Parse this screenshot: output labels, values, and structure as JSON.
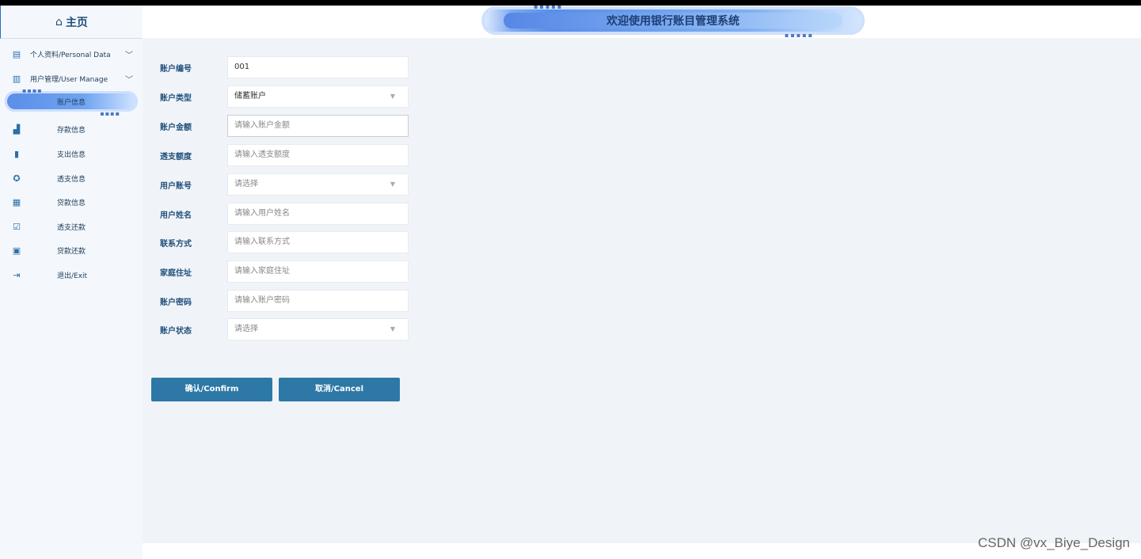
{
  "app": {
    "title": "欢迎使用银行账目管理系统"
  },
  "sidebar": {
    "home_label": "主页",
    "groups": [
      {
        "label": "个人资料/Personal Data",
        "icon": "document-icon"
      },
      {
        "label": "用户管理/User Manage",
        "icon": "clipboard-icon"
      }
    ],
    "active_item": "账户信息",
    "items": [
      {
        "label": "存款信息",
        "icon": "bar-chart-icon"
      },
      {
        "label": "支出信息",
        "icon": "bookmark-icon"
      },
      {
        "label": "透支信息",
        "icon": "badge-icon"
      },
      {
        "label": "贷款信息",
        "icon": "calendar-icon"
      },
      {
        "label": "透支还款",
        "icon": "calendar-check-icon"
      },
      {
        "label": "贷款还款",
        "icon": "book-icon"
      },
      {
        "label": "退出/Exit",
        "icon": "logout-icon"
      }
    ]
  },
  "form": {
    "fields": [
      {
        "label": "账户编号",
        "value": "001",
        "placeholder": ""
      },
      {
        "label": "账户类型",
        "value": "储蓄账户",
        "placeholder": ""
      },
      {
        "label": "账户金额",
        "value": "",
        "placeholder": "请输入账户金额"
      },
      {
        "label": "透支额度",
        "value": "",
        "placeholder": "请输入透支额度"
      },
      {
        "label": "用户账号",
        "value": "",
        "placeholder": "请选择"
      },
      {
        "label": "用户姓名",
        "value": "",
        "placeholder": "请输入用户姓名"
      },
      {
        "label": "联系方式",
        "value": "",
        "placeholder": "请输入联系方式"
      },
      {
        "label": "家庭住址",
        "value": "",
        "placeholder": "请输入家庭住址"
      },
      {
        "label": "账户密码",
        "value": "",
        "placeholder": "请输入账户密码"
      },
      {
        "label": "账户状态",
        "value": "",
        "placeholder": "请选择"
      }
    ],
    "confirm_label": "确认/Confirm",
    "cancel_label": "取消/Cancel"
  },
  "watermark": "CSDN @vx_Biye_Design"
}
